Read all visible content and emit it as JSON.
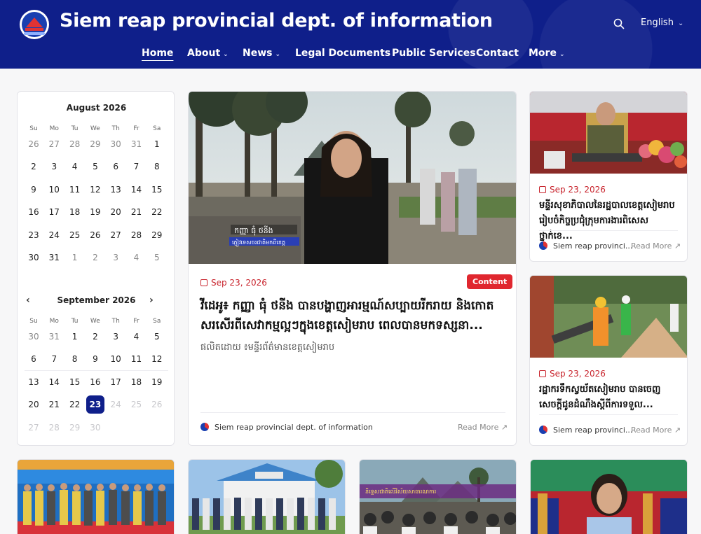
{
  "header": {
    "site_title": "Siem reap provincial dept. of information",
    "language": "English",
    "nav": [
      {
        "label": "Home",
        "has_menu": false
      },
      {
        "label": "About",
        "has_menu": true
      },
      {
        "label": "News",
        "has_menu": true
      },
      {
        "label": "Legal Documents",
        "has_menu": false
      },
      {
        "label": "Public Services",
        "has_menu": false
      },
      {
        "label": "Contact",
        "has_menu": false
      },
      {
        "label": "More",
        "has_menu": true
      }
    ]
  },
  "calendar": {
    "weekdays": [
      "Su",
      "Mo",
      "Tu",
      "We",
      "Th",
      "Fr",
      "Sa"
    ],
    "months": [
      {
        "title": "August 2026",
        "days": [
          "26",
          "27",
          "28",
          "29",
          "30",
          "31",
          "1",
          "2",
          "3",
          "4",
          "5",
          "6",
          "7",
          "8",
          "9",
          "10",
          "11",
          "12",
          "13",
          "14",
          "15",
          "16",
          "17",
          "18",
          "19",
          "20",
          "21",
          "22",
          "23",
          "24",
          "25",
          "26",
          "27",
          "28",
          "29",
          "30",
          "31",
          "1",
          "2",
          "3",
          "4",
          "5"
        ]
      },
      {
        "title": "September 2026",
        "days": [
          "30",
          "31",
          "1",
          "2",
          "3",
          "4",
          "5",
          "6",
          "7",
          "8",
          "9",
          "10",
          "11",
          "12",
          "13",
          "14",
          "15",
          "16",
          "17",
          "18",
          "19",
          "20",
          "21",
          "22",
          "23",
          "24",
          "25",
          "26",
          "27",
          "28",
          "29",
          "30"
        ],
        "selected": "23"
      }
    ],
    "prev_label": "‹",
    "next_label": "›"
  },
  "main_article": {
    "date": "Sep 23, 2026",
    "badge": "Content",
    "headline": "វីដេអូ៖ កញ្ញា ធុំ ថនីង បានបង្ហាញអារម្មណ៍សប្បាយរីករាយ និងកោតសរសើរពីសេវាកម្មល្អៗក្នុងខេត្តសៀមរាប ពេលបានមកទស្សនា...",
    "byline": "ផលិតដោយ ៖មន្ទីរព័ត៌មានខេត្តសៀមរាប",
    "photo_caption_name": "កញ្ញា ធុំ ថនីង",
    "photo_caption_role": "ភ្ញៀវទេសចរជាតិមកពីខេត្ត",
    "source": "Siem reap provincial dept. of information",
    "read_more": "Read More"
  },
  "side_articles": [
    {
      "date": "Sep 23, 2026",
      "headline": "មន្ទីរសុខាភិបាលនៃរដ្ឋបាលខេត្តសៀមរាប រៀបចំកិច្ចប្រជុំក្រុមការងារពិសេសថ្នាក់ខេ...",
      "source": "Siem reap provinci...",
      "read_more": "Read More"
    },
    {
      "date": "Sep 23, 2026",
      "headline": "រដ្ឋាករទឹកស្វយ័តសៀមរាប បានចេញសេចក្ដីជូនដំណឹងស្តីពីការទទួល...",
      "source": "Siem reap provinci...",
      "read_more": "Read More"
    }
  ],
  "bottom_photos": [
    {
      "banner_text": ""
    },
    {
      "banner_text": ""
    },
    {
      "banner_text": "និទ្ទេសជាតិលើវិស័យសាធារណការ"
    },
    {
      "banner_text": ""
    }
  ],
  "colors": {
    "header_bg": "#0f1f8a",
    "accent_red": "#e0272f",
    "date_red": "#c8232c",
    "selected_day": "#0f1f8a"
  }
}
